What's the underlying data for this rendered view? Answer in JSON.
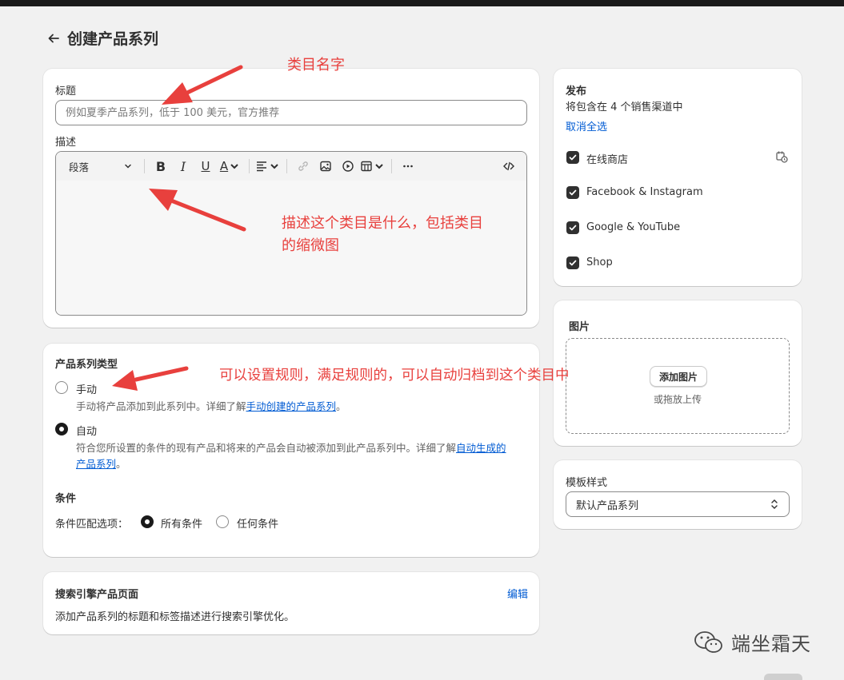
{
  "header": {
    "title": "创建产品系列"
  },
  "main": {
    "title_label": "标题",
    "title_placeholder": "例如夏季产品系列，低于 100 美元，官方推荐",
    "description_label": "描述",
    "toolbar": {
      "paragraph_select": "段落",
      "bold": "B",
      "italic": "I",
      "underline": "U",
      "text_color": "A"
    }
  },
  "collection_type": {
    "heading": "产品系列类型",
    "manual": {
      "label": "手动",
      "help_prefix": "手动将产品添加到此系列中。详细了解",
      "help_link": "手动创建的产品系列",
      "help_suffix": "。",
      "selected": false
    },
    "automatic": {
      "label": "自动",
      "help_prefix": "符合您所设置的条件的现有产品和将来的产品会自动被添加到此产品系列中。详细了解",
      "help_link_line1": "自动生成的",
      "help_link_line2": "产品系列",
      "help_suffix": "。",
      "selected": true
    },
    "conditions_heading": "条件",
    "match_label": "条件匹配选项：",
    "match_all": "所有条件",
    "match_any": "任何条件",
    "match_selected": "all"
  },
  "seo": {
    "heading": "搜索引擎产品页面",
    "edit": "编辑",
    "description": "添加产品系列的标题和标签描述进行搜索引擎优化。"
  },
  "publishing": {
    "heading": "发布",
    "subtitle": "将包含在 4 个销售渠道中",
    "deselect_all": "取消全选",
    "channels": [
      {
        "name": "在线商店",
        "checked": true
      },
      {
        "name": "Facebook & Instagram",
        "checked": true
      },
      {
        "name": "Google & YouTube",
        "checked": true
      },
      {
        "name": "Shop",
        "checked": true
      }
    ]
  },
  "image": {
    "heading": "图片",
    "add_button": "添加图片",
    "drop_hint": "或拖放上传"
  },
  "template": {
    "label": "模板样式",
    "value": "默认产品系列"
  },
  "annotations": {
    "title_note": "类目名字",
    "desc_note_line1": "描述这个类目是什么，包括类目",
    "desc_note_line2": "的缩微图",
    "type_note": "可以设置规则，满足规则的，可以自动归档到这个类目中"
  },
  "watermark": {
    "text": "端坐霜天"
  },
  "colors": {
    "annotation": "#e8403d",
    "link": "#005bd3",
    "checkbox": "#303030",
    "page_bg": "#f1f1f1"
  }
}
